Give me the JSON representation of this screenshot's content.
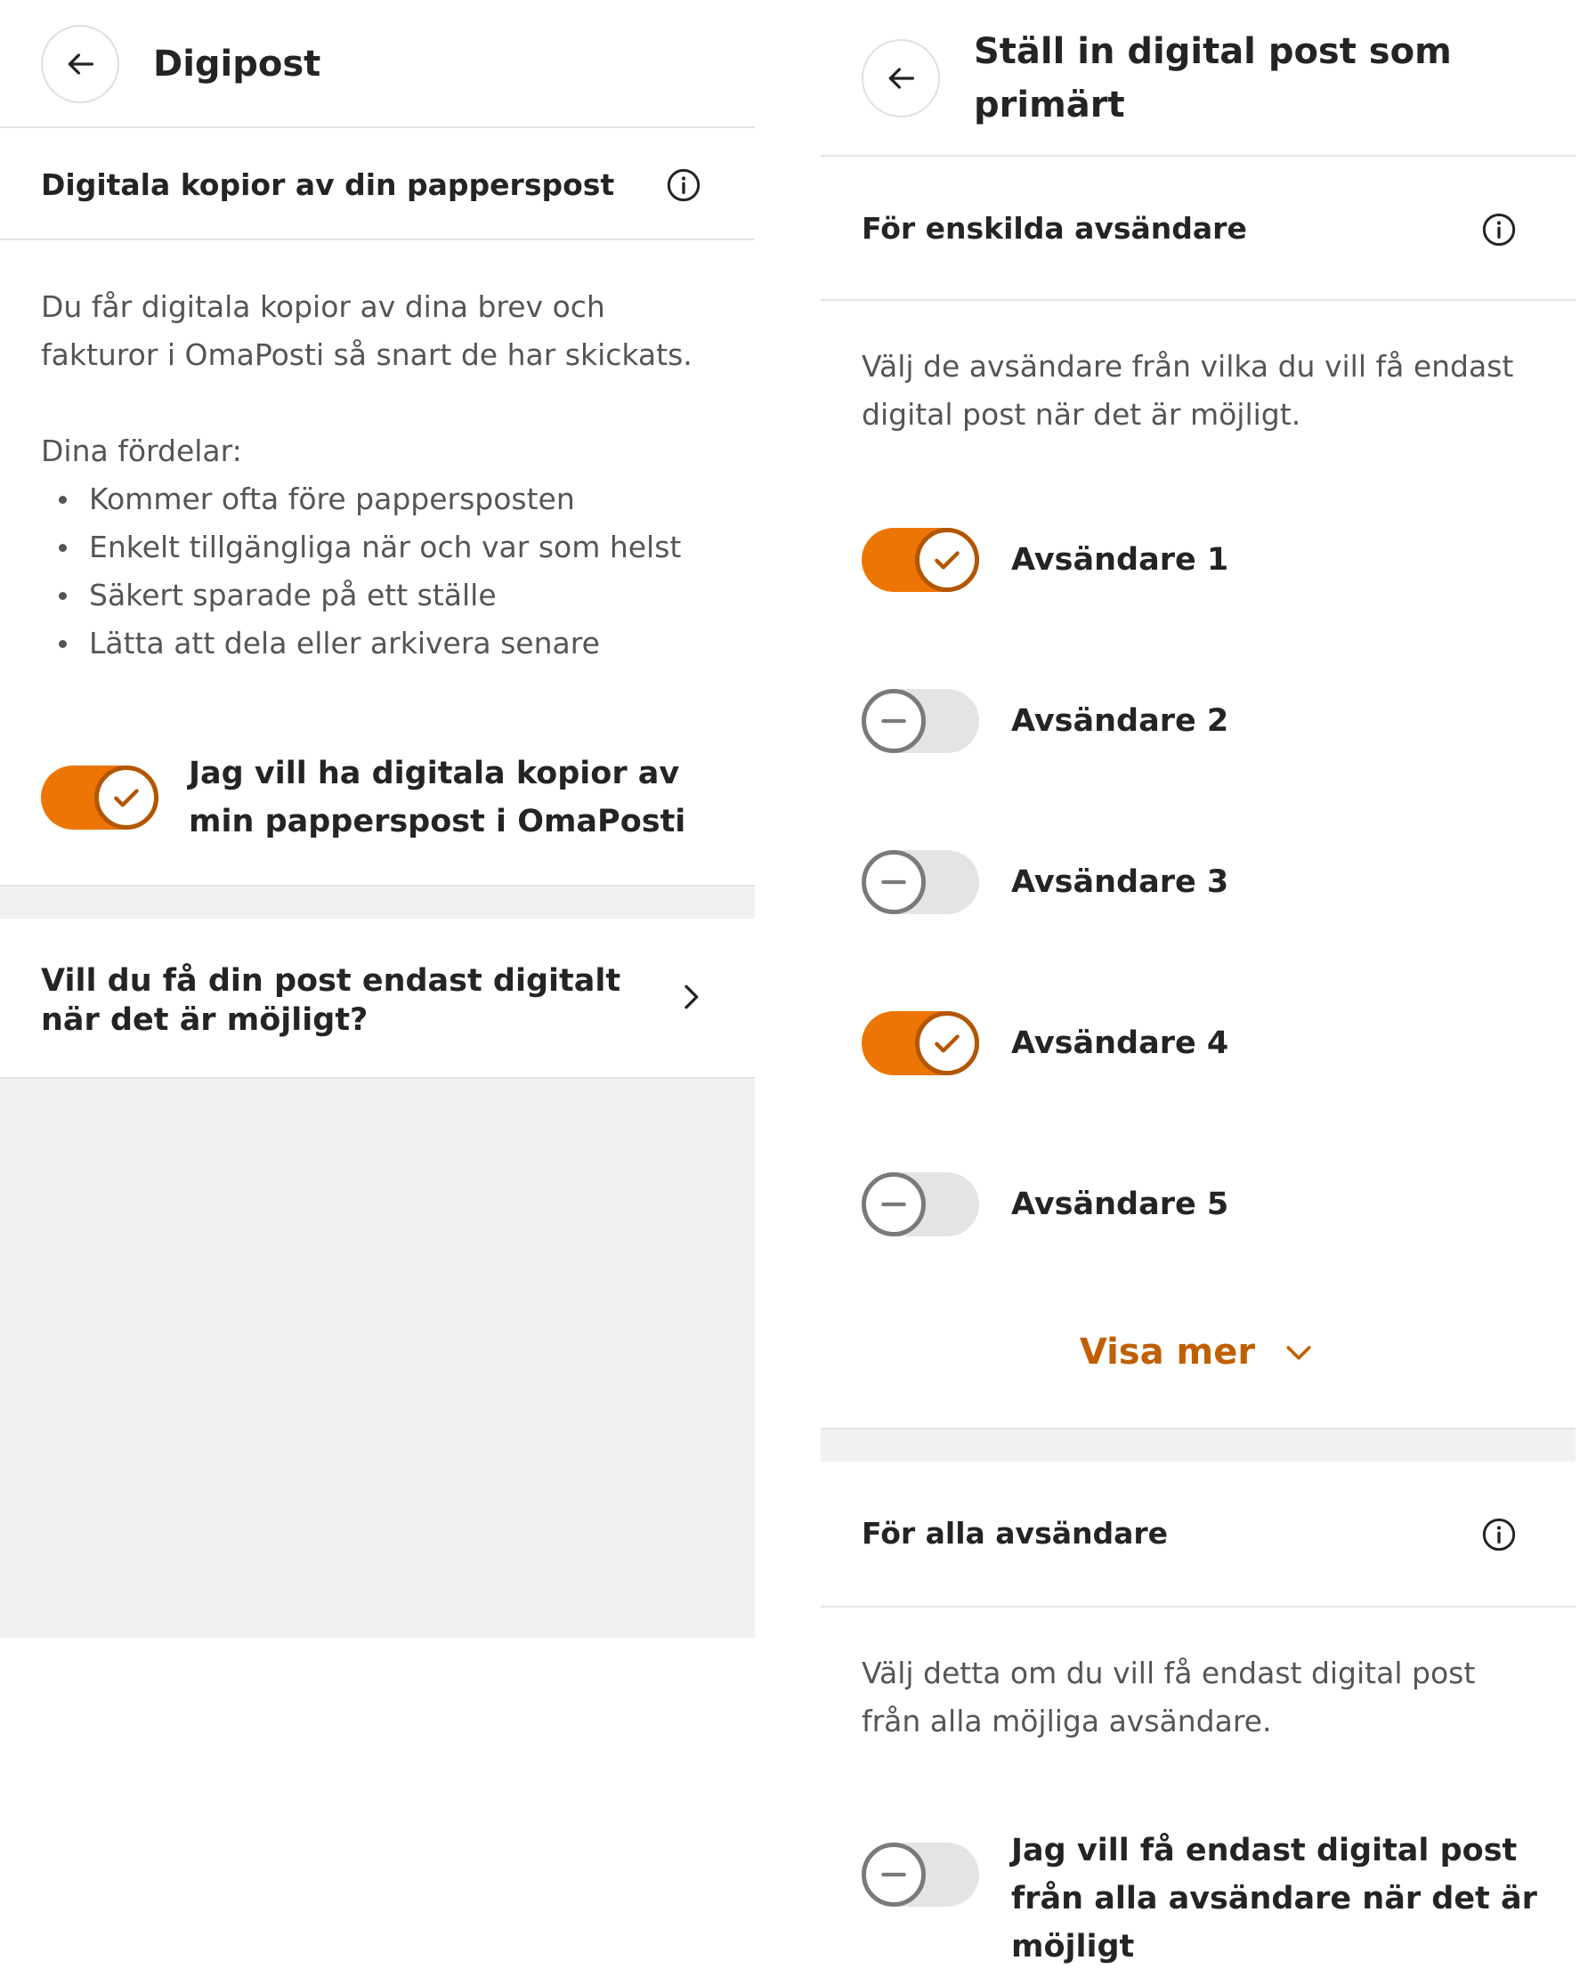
{
  "colors": {
    "accent": "#ed7504",
    "accent_dark": "#b35600",
    "link": "#c05f00",
    "toggle_off_track": "#e4e4e4",
    "gray_background": "#f1f1f1"
  },
  "left": {
    "header": {
      "title": "Digipost",
      "back_icon": "arrow-left-icon"
    },
    "section": {
      "title": "Digitala kopior av din papperspost",
      "info_icon": "info-icon"
    },
    "description": "Du får digitala kopior av dina brev och fakturor i OmaPosti så snart de har skickats.",
    "benefits_heading": "Dina fördelar:",
    "benefits": [
      "Kommer ofta före pappersposten",
      "Enkelt tillgängliga när och var som helst",
      "Säkert sparade på ett ställe",
      "Lätta att dela eller arkivera senare"
    ],
    "toggle": {
      "label": "Jag vill ha digitala kopior av min papperspost i OmaPosti",
      "checked": true
    },
    "nav_item": {
      "label": "Vill du få din post endast digitalt när det är möjligt?",
      "icon": "chevron-right-icon"
    }
  },
  "right": {
    "header": {
      "title": "Ställ in digital post som primärt",
      "back_icon": "arrow-left-icon"
    },
    "individual": {
      "title": "För enskilda avsändare",
      "info_icon": "info-icon",
      "description": "Välj de avsändare från vilka du vill få endast digital post när det är möjligt.",
      "senders": [
        {
          "label": "Avsändare 1",
          "checked": true
        },
        {
          "label": "Avsändare 2",
          "checked": false
        },
        {
          "label": "Avsändare 3",
          "checked": false
        },
        {
          "label": "Avsändare 4",
          "checked": true
        },
        {
          "label": "Avsändare 5",
          "checked": false
        }
      ],
      "show_more": {
        "label": "Visa mer",
        "icon": "chevron-down-icon"
      }
    },
    "all": {
      "title": "För alla avsändare",
      "info_icon": "info-icon",
      "description": "Välj detta om du vill få endast digital post från alla möjliga avsändare.",
      "toggle": {
        "label": "Jag vill få endast digital post från alla avsändare när det är möjligt",
        "checked": false
      }
    }
  }
}
